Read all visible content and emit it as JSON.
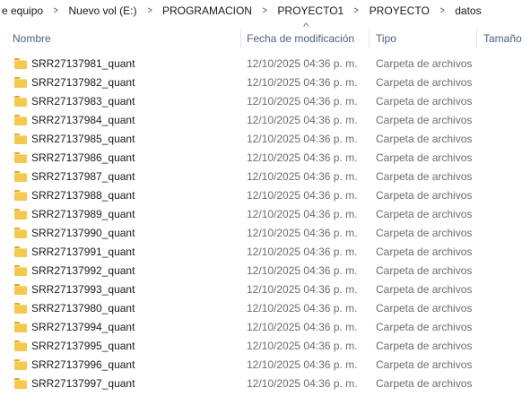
{
  "breadcrumb": [
    "e equipo",
    "Nuevo vol (E:)",
    "PROGRAMACION",
    "PROYECTO1",
    "PROYECTO",
    "datos"
  ],
  "columns": {
    "name": "Nombre",
    "date": "Fecha de modificación",
    "type": "Tipo",
    "size": "Tamaño"
  },
  "rows": [
    {
      "name": "SRR27137981_quant",
      "date": "12/10/2025 04:36 p. m.",
      "type": "Carpeta de archivos"
    },
    {
      "name": "SRR27137982_quant",
      "date": "12/10/2025 04:36 p. m.",
      "type": "Carpeta de archivos"
    },
    {
      "name": "SRR27137983_quant",
      "date": "12/10/2025 04:36 p. m.",
      "type": "Carpeta de archivos"
    },
    {
      "name": "SRR27137984_quant",
      "date": "12/10/2025 04:36 p. m.",
      "type": "Carpeta de archivos"
    },
    {
      "name": "SRR27137985_quant",
      "date": "12/10/2025 04:36 p. m.",
      "type": "Carpeta de archivos"
    },
    {
      "name": "SRR27137986_quant",
      "date": "12/10/2025 04:36 p. m.",
      "type": "Carpeta de archivos"
    },
    {
      "name": "SRR27137987_quant",
      "date": "12/10/2025 04:36 p. m.",
      "type": "Carpeta de archivos"
    },
    {
      "name": "SRR27137988_quant",
      "date": "12/10/2025 04:36 p. m.",
      "type": "Carpeta de archivos"
    },
    {
      "name": "SRR27137989_quant",
      "date": "12/10/2025 04:36 p. m.",
      "type": "Carpeta de archivos"
    },
    {
      "name": "SRR27137990_quant",
      "date": "12/10/2025 04:36 p. m.",
      "type": "Carpeta de archivos"
    },
    {
      "name": "SRR27137991_quant",
      "date": "12/10/2025 04:36 p. m.",
      "type": "Carpeta de archivos"
    },
    {
      "name": "SRR27137992_quant",
      "date": "12/10/2025 04:36 p. m.",
      "type": "Carpeta de archivos"
    },
    {
      "name": "SRR27137993_quant",
      "date": "12/10/2025 04:36 p. m.",
      "type": "Carpeta de archivos"
    },
    {
      "name": "SRR27137980_quant",
      "date": "12/10/2025 04:36 p. m.",
      "type": "Carpeta de archivos"
    },
    {
      "name": "SRR27137994_quant",
      "date": "12/10/2025 04:36 p. m.",
      "type": "Carpeta de archivos"
    },
    {
      "name": "SRR27137995_quant",
      "date": "12/10/2025 04:36 p. m.",
      "type": "Carpeta de archivos"
    },
    {
      "name": "SRR27137996_quant",
      "date": "12/10/2025 04:36 p. m.",
      "type": "Carpeta de archivos"
    },
    {
      "name": "SRR27137997_quant",
      "date": "12/10/2025 04:36 p. m.",
      "type": "Carpeta de archivos"
    }
  ],
  "icons": {
    "folder": "folder-icon",
    "separator": "chevron-right-icon",
    "sort": "sort-ascending-icon"
  },
  "colors": {
    "folder": "#f5c94f",
    "header_text": "#4c607a",
    "secondary_text": "#6d6d6d"
  }
}
